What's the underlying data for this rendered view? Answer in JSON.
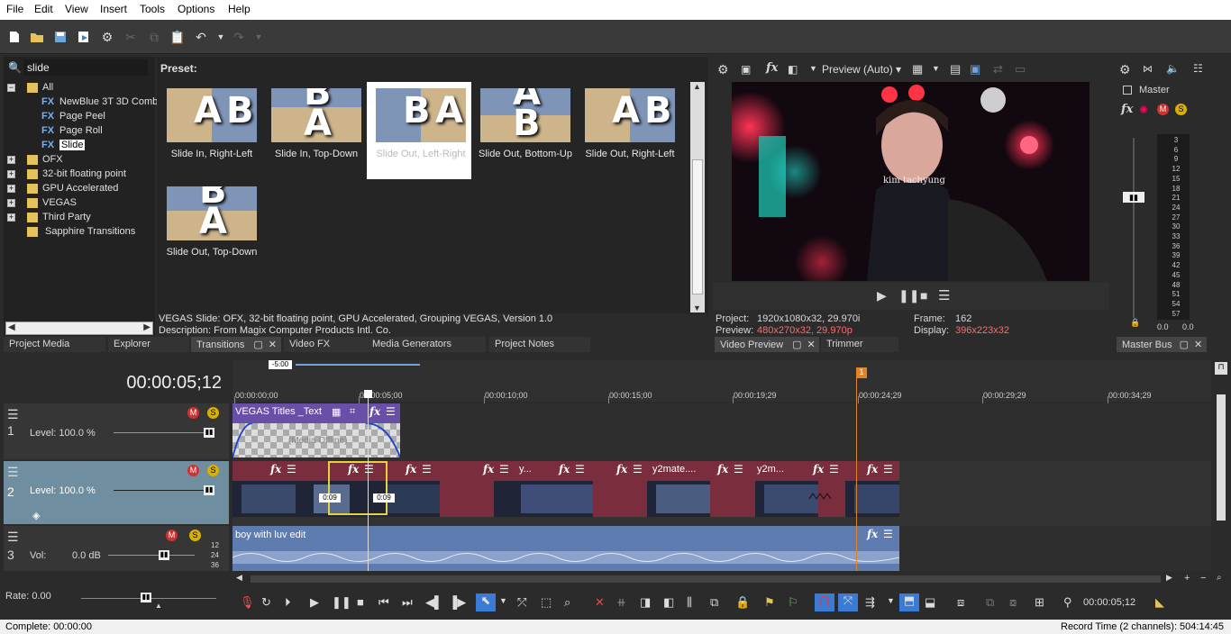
{
  "menu": [
    "File",
    "Edit",
    "View",
    "Insert",
    "Tools",
    "Options",
    "Help"
  ],
  "search": {
    "value": "slide"
  },
  "tree": [
    {
      "label": "All",
      "type": "folder",
      "level": 0,
      "expanded": true
    },
    {
      "label": "NewBlue 3T 3D Comb",
      "type": "fx",
      "level": 1
    },
    {
      "label": "Page Peel",
      "type": "fx",
      "level": 1
    },
    {
      "label": "Page Roll",
      "type": "fx",
      "level": 1
    },
    {
      "label": "Slide",
      "type": "fx",
      "level": 1,
      "selected": true
    },
    {
      "label": "OFX",
      "type": "folder",
      "level": 0
    },
    {
      "label": "32-bit floating point",
      "type": "folder",
      "level": 0
    },
    {
      "label": "GPU Accelerated",
      "type": "folder",
      "level": 0
    },
    {
      "label": "VEGAS",
      "type": "folder",
      "level": 0
    },
    {
      "label": "Third Party",
      "type": "folder",
      "level": 0
    },
    {
      "label": "Sapphire Transitions",
      "type": "folder",
      "level": 0,
      "noexpander": true
    }
  ],
  "preset": {
    "header": "Preset:",
    "items": [
      {
        "label": "Slide In, Right-Left",
        "letters": "A B"
      },
      {
        "label": "Slide In, Top-Down",
        "letters": "B A"
      },
      {
        "label": "Slide Out, Left-Right",
        "letters": "B A",
        "selected": true
      },
      {
        "label": "Slide Out, Bottom-Up",
        "letters": "A B"
      },
      {
        "label": "Slide Out, Right-Left",
        "letters": "A B"
      },
      {
        "label": "Slide Out, Top-Down",
        "letters": "B A"
      }
    ],
    "info1": "VEGAS Slide: OFX, 32-bit floating point, GPU Accelerated, Grouping VEGAS, Version 1.0",
    "info2": "Description: From Magix Computer Products Intl. Co."
  },
  "leftTabs": [
    "Project Media",
    "Explorer",
    "Transitions",
    "Video FX",
    "Media Generators",
    "Project Notes"
  ],
  "previewPanel": {
    "quality": "Preview (Auto)",
    "videoCaption": "kim tachyung",
    "projectLabel": "Project:",
    "projectValue": "1920x1080x32, 29.970i",
    "previewLabel": "Preview:",
    "previewValue": "480x270x32, 29.970p",
    "frameLabel": "Frame:",
    "frameValue": "162",
    "displayLabel": "Display:",
    "displayValue": "396x223x32",
    "tabs": [
      "Video Preview",
      "Trimmer"
    ]
  },
  "masterPanel": {
    "title": "Master",
    "scale": [
      "3",
      "6",
      "9",
      "12",
      "15",
      "18",
      "21",
      "24",
      "27",
      "30",
      "33",
      "36",
      "39",
      "42",
      "45",
      "48",
      "51",
      "54",
      "57"
    ],
    "levelL": "0.0",
    "levelR": "0.0",
    "tab": "Master Bus"
  },
  "timeline": {
    "timecode": "00:00:05;12",
    "loopLabel": "-5:00",
    "markerLabel": "1",
    "ruler": [
      "00:00:00;00",
      "00:00:05;00",
      "00:00:10;00",
      "00:00:15;00",
      "00:00:19;29",
      "00:00:24;29",
      "00:00:29;29",
      "00:00:34;29"
    ],
    "tracks": [
      {
        "num": "1",
        "label": "Level: 100.0 %"
      },
      {
        "num": "2",
        "label": "Level: 100.0 %"
      },
      {
        "num": "3",
        "label": "Vol:",
        "value": "0.0 dB"
      }
    ],
    "meterScale": [
      "12",
      "24",
      "36"
    ],
    "clip1Title": "VEGAS Titles _Text",
    "clip1Media": "(Media Offline)",
    "clip3Title": "boy with luv edit",
    "v2Clips": [
      "y...",
      "y2mate....",
      "y2m..."
    ],
    "fade1": "0:09",
    "fade2": "0:09",
    "rate": "Rate: 0.00"
  },
  "transport": {
    "timecode": "00:00:05;12"
  },
  "status": {
    "left": "Complete: 00:00:00",
    "right": "Record Time (2 channels): 504:14:45"
  }
}
